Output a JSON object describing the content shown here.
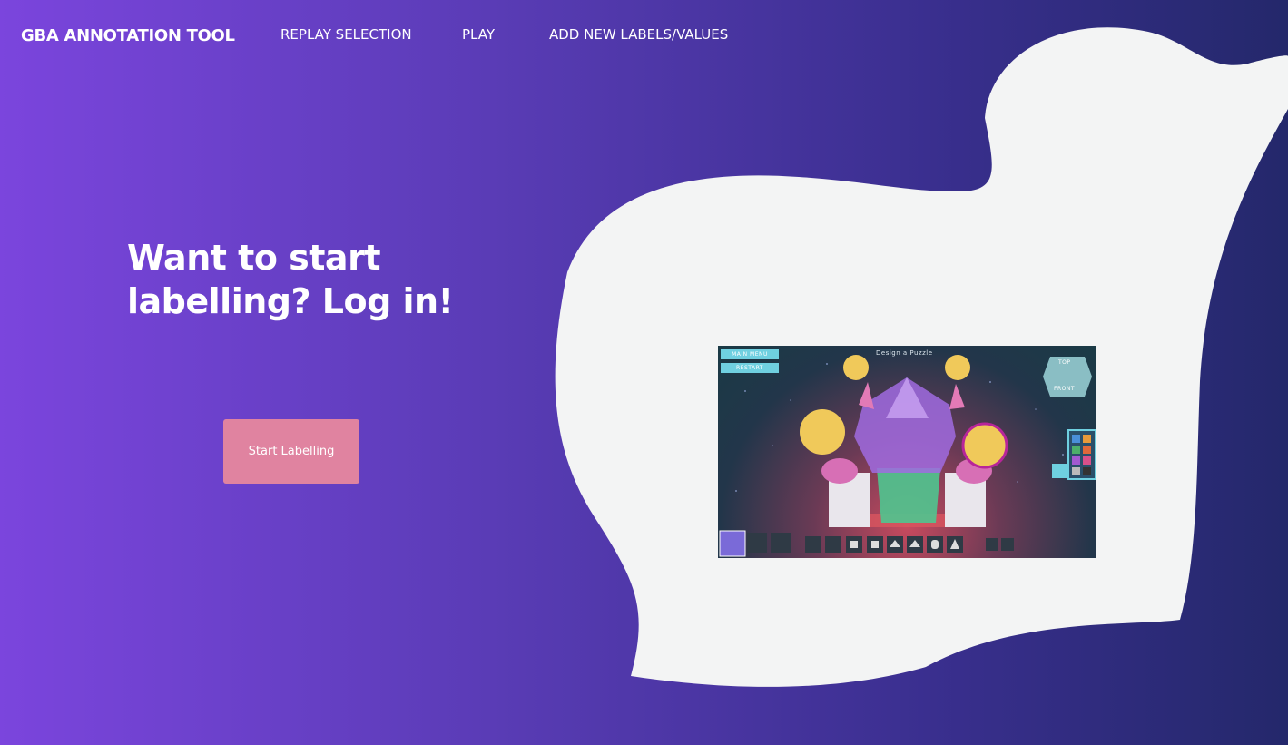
{
  "nav": {
    "brand": "GBA ANNOTATION TOOL",
    "links": [
      {
        "label": "REPLAY SELECTION"
      },
      {
        "label": "PLAY"
      },
      {
        "label": "ADD NEW LABELS/VALUES"
      }
    ]
  },
  "hero": {
    "title_line1": "Want to start",
    "title_line2": "labelling? Log in!",
    "cta_label": "Start Labelling"
  },
  "preview": {
    "title": "Design a Puzzle",
    "menu_buttons": [
      "MAIN MENU",
      "RESTART"
    ],
    "view_labels": [
      "TOP",
      "FRONT"
    ]
  },
  "colors": {
    "gradient_start": "#7b45dd",
    "gradient_end": "#24286b",
    "cta": "#e083a0",
    "blob": "#f3f4f4"
  }
}
